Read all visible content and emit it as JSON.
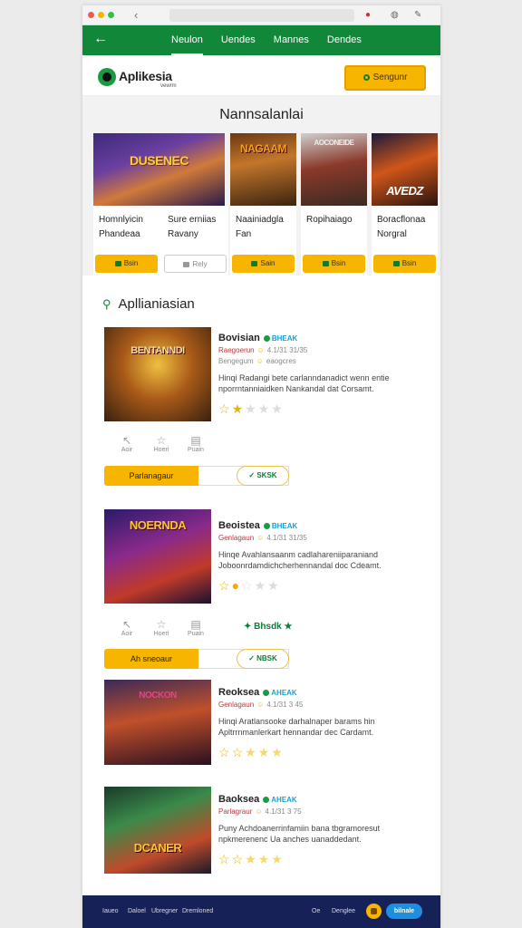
{
  "browser": {
    "dot_colors": [
      "#f05a4f",
      "#f7b500",
      "#34c148"
    ],
    "back": "‹",
    "icons": [
      "record-icon",
      "lock-icon",
      "edit-icon"
    ]
  },
  "nav": {
    "back": "←",
    "tabs": [
      "Neulon",
      "Uendes",
      "Mannes",
      "Dendes"
    ],
    "active_tab": 0
  },
  "header": {
    "logo_text": "Aplikesia",
    "logo_sub": "vewrm",
    "cta": "Sengunr"
  },
  "featured": {
    "title": "Nannsalanlai",
    "cards": [
      {
        "art_word": "DUSENEC",
        "name": "Homnlyicin Phandeaa",
        "button": "Bsin",
        "style": "primary"
      },
      {
        "art_word": "",
        "name": "Sure erniias Ravany",
        "button": "Rely",
        "style": "secondary"
      },
      {
        "art_word": "NAGAAM",
        "name": "Naainiadgla Fan",
        "button": "Sain",
        "style": "primary"
      },
      {
        "art_word": "AOCONEIDE",
        "name": "Ropihaiago",
        "button": "Bsin",
        "style": "primary"
      },
      {
        "art_word": "AVEDZ",
        "name": "Boracflonaa Norgral",
        "button": "Bsin",
        "style": "primary"
      }
    ]
  },
  "apps_section": {
    "title": "Apllianiasian",
    "actions": [
      "Aoir",
      "Hoeri",
      "Puain"
    ],
    "apps": [
      {
        "art_word": "BENTANNDI",
        "title": "Bovisian",
        "badge": "BHEAK",
        "category": "Raegoerun",
        "meta": "4.1/31 31/35",
        "sub": "Bengegum",
        "sub2": "eaogcres",
        "description": "Hinqi Radangi bete carlanndanadict wenn entie nporrntanniaidken Nankandal dat Corsamt.",
        "rating": 2,
        "button": "Parlanagaur",
        "pill": "SKSK"
      },
      {
        "art_word": "NOERNDA",
        "title": "Beoistea",
        "badge": "BHEAK",
        "category": "Genlagaun",
        "meta": "4.1/31 31/35",
        "description": "Hinqe Avahlansaanm cadlahareniiparaniand Joboonrdamdichcherhennandal doc Cdeamt.",
        "rating": 1.5,
        "button": "Ah sneoaur",
        "pill": "NBSK"
      },
      {
        "art_word": "NOCKON",
        "title": "Reoksea",
        "badge": "AHEAK",
        "category": "Genlagaun",
        "meta": "4.1/31 3 45",
        "description": "Hinqi Aratlansooke darhalnaper barams hin Apltrrnmanlerkart hennandar dec Cardamt.",
        "rating": 2,
        "button": "",
        "pill": ""
      },
      {
        "art_word": "DCANER",
        "title": "Baoksea",
        "badge": "AHEAK",
        "category": "Parlagraur",
        "meta": "4.1/31 3 75",
        "description": "Puny Achdoanerrinfamiin bana tbgramoresut npkmerenenc Ua anches uanaddedant.",
        "rating": 2,
        "button": "",
        "pill": ""
      }
    ],
    "floating_badge": "Bhsdk"
  },
  "footer": {
    "links": [
      "Iaueo",
      "Daloel",
      "Ubregner",
      "Dremloned"
    ],
    "right_link": "Denglee",
    "small": "Oe",
    "pill": "bilnale"
  }
}
